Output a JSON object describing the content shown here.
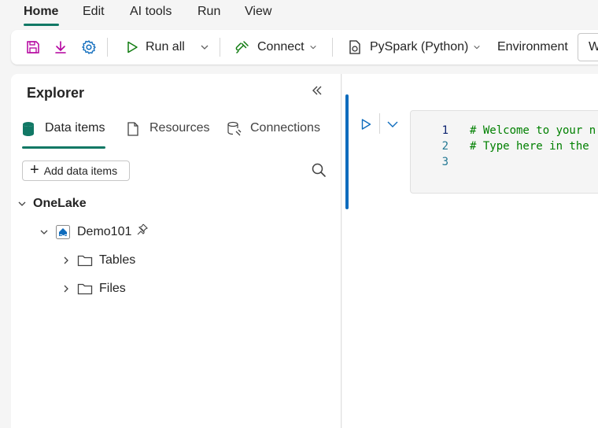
{
  "menu": {
    "items": [
      {
        "label": "Home",
        "active": true
      },
      {
        "label": "Edit"
      },
      {
        "label": "AI tools"
      },
      {
        "label": "Run"
      },
      {
        "label": "View"
      }
    ]
  },
  "toolbar": {
    "run_all": "Run all",
    "connect": "Connect",
    "language": "PySpark (Python)",
    "environment": "Environment",
    "environment_value": "W"
  },
  "explorer": {
    "title": "Explorer",
    "tabs": [
      {
        "label": "Data items",
        "active": true
      },
      {
        "label": "Resources"
      },
      {
        "label": "Connections"
      }
    ],
    "add_button": "Add data items",
    "tree": {
      "root": "OneLake",
      "item": "Demo101",
      "children": [
        "Tables",
        "Files"
      ]
    }
  },
  "editor": {
    "line_numbers": [
      "1",
      "2",
      "3"
    ],
    "lines": [
      "# Welcome to your n",
      "# Type here in the ",
      ""
    ]
  },
  "colors": {
    "accent": "#117865",
    "cell_active": "#0f6cbd",
    "code_comment": "#008000"
  }
}
